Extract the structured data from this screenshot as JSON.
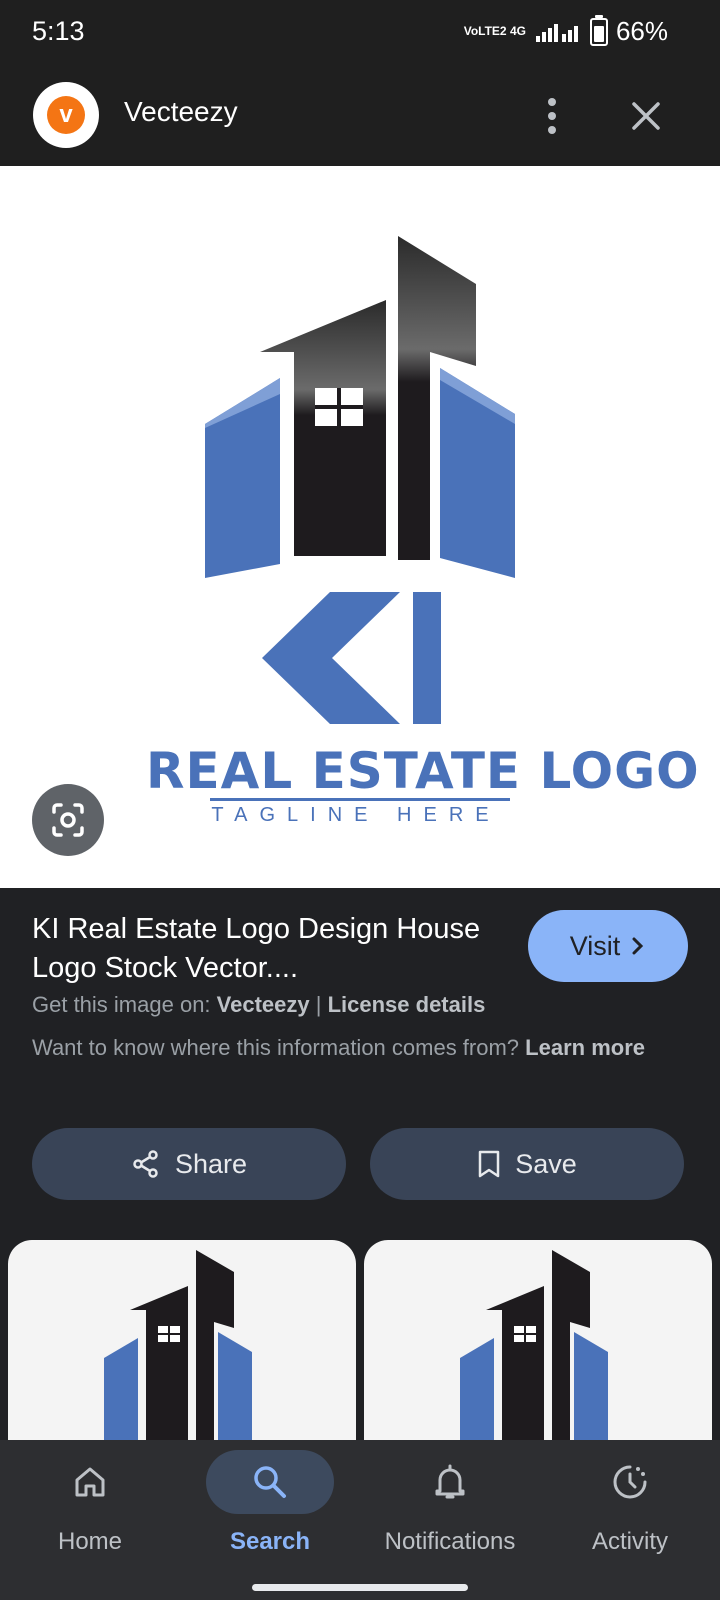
{
  "status": {
    "time": "5:13",
    "network": "VoLTE2 4G",
    "battery": "66%",
    "battery_level": 0.66
  },
  "header": {
    "site_name": "Vecteezy",
    "logo_letter": "v",
    "menu_icon": "more-vert-icon",
    "close_icon": "close-icon"
  },
  "hero": {
    "logo_big_text": "REAL ESTATE LOGO",
    "logo_tagline": "TAGLINE HERE",
    "lens_icon": "google-lens-icon"
  },
  "result": {
    "title": "KI Real Estate Logo Design House Logo Stock Vector....",
    "visit_label": "Visit",
    "source_prefix": "Get this image on:",
    "source_name": "Vecteezy",
    "separator": " | ",
    "license": "License details",
    "disclaimer": "Want to know where this information comes from?",
    "learn_more": "Learn more"
  },
  "actions": {
    "share_label": "Share",
    "save_label": "Save"
  },
  "nav": {
    "items": [
      {
        "label": "Home",
        "icon": "home-icon"
      },
      {
        "label": "Search",
        "icon": "search-icon",
        "active": true
      },
      {
        "label": "Notifications",
        "icon": "bell-icon"
      },
      {
        "label": "Activity",
        "icon": "activity-icon"
      }
    ]
  },
  "colors": {
    "brand_orange": "#f47514",
    "logo_blue": "#4a72b9",
    "accent": "#8ab4f8",
    "surface": "#202124"
  }
}
